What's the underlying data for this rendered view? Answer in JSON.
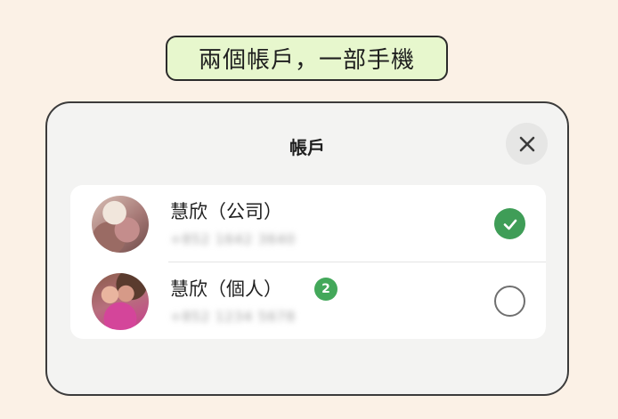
{
  "banner": {
    "text": "兩個帳戶，一部手機"
  },
  "sheet": {
    "title": "帳戶",
    "close_icon": "close-icon"
  },
  "accounts": [
    {
      "name": "慧欣（公司）",
      "phone": "+852 1642 3640",
      "selected": true,
      "badge": null,
      "avatar_icon": "avatar-photo"
    },
    {
      "name": "慧欣（個人）",
      "phone": "+852 1234 5678",
      "selected": false,
      "badge": "2",
      "avatar_icon": "avatar-photo"
    }
  ],
  "colors": {
    "page_background": "#fbf1e6",
    "banner_background": "#e7f7cd",
    "selected_green": "#3f9d57",
    "badge_green": "#43a85a"
  }
}
